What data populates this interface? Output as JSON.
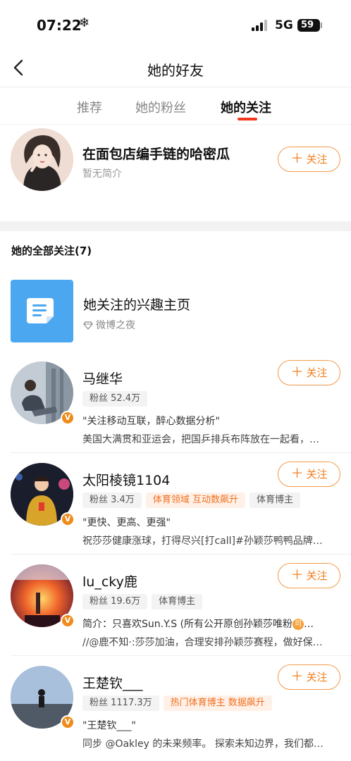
{
  "status": {
    "time": "07:22",
    "network": "5G",
    "battery": "59"
  },
  "nav": {
    "title": "她的好友"
  },
  "tabs": [
    {
      "label": "推荐"
    },
    {
      "label": "她的粉丝"
    },
    {
      "label": "她的关注"
    }
  ],
  "featured": {
    "name": "在面包店编手链的哈密瓜",
    "intro": "暂无简介",
    "follow_label": "关注"
  },
  "section": {
    "title": "她的全部关注(7)"
  },
  "interest": {
    "title": "她关注的兴趣主页",
    "subtitle": "微博之夜"
  },
  "users": [
    {
      "name": "马继华",
      "tags": [
        "粉丝 52.4万"
      ],
      "hot_tags": [],
      "extra_tags": [],
      "desc": "\"关注移动互联，醉心数据分析\"",
      "desc2": "美国大满贯和亚运会，把国乒排兵布阵放在一起看，…",
      "follow_label": "关注"
    },
    {
      "name": "太阳棱镜1104",
      "tags": [
        "粉丝 3.4万"
      ],
      "hot_tags": [
        "体育领域 互动数飙升"
      ],
      "extra_tags": [
        "体育博主"
      ],
      "desc": "\"更快、更高、更强\"",
      "desc2": "祝莎莎健康涨球，打得尽兴[打call]#孙颖莎鸭鸭品牌…",
      "follow_label": "关注"
    },
    {
      "name": "lu_cky鹿",
      "tags": [
        "粉丝 19.6万",
        "体育博主"
      ],
      "hot_tags": [],
      "extra_tags": [],
      "desc": "简介：只喜欢Sun.Y.S (所有公开原创孙颖莎唯粉",
      "desc_badge": "司",
      "desc2": "//@鹿不知·:莎莎加油，合理安排孙颖莎赛程，做好保…",
      "follow_label": "关注"
    },
    {
      "name": "王楚钦___",
      "tags": [
        "粉丝 1117.3万"
      ],
      "hot_tags": [
        "热门体育博主 数据飙升"
      ],
      "extra_tags": [],
      "desc": "\"王楚钦___\"",
      "desc2": "同步 @Oakley 的未来频率。 探索未知边界，我们都…",
      "follow_label": "关注"
    }
  ],
  "colors": {
    "accent": "#f08020",
    "tab_indicator": "#f2381f",
    "badge": "#f08a1a",
    "interest_bg": "#4aa7f0"
  }
}
